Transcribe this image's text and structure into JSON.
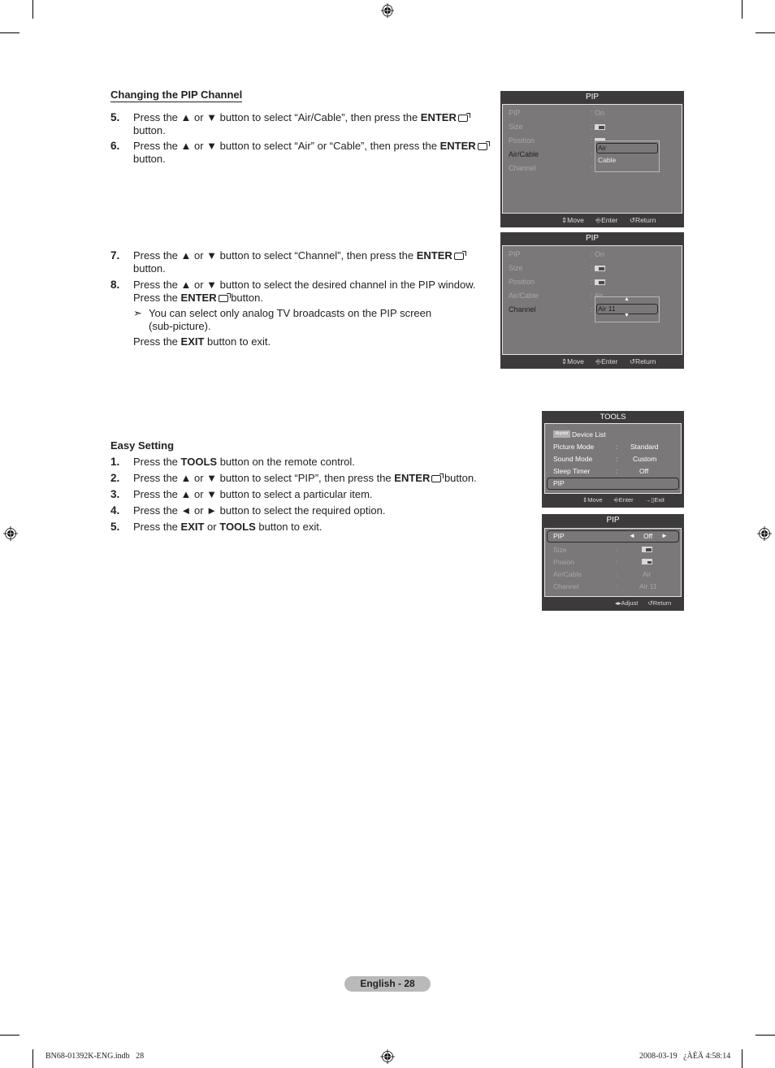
{
  "section1": {
    "heading": "Changing the PIP Channel",
    "steps": [
      {
        "num": "5.",
        "pre": "Press the ▲ or ▼ button to select “Air/Cable”, then press the ",
        "bold": "ENTER",
        "post": " button."
      },
      {
        "num": "6.",
        "pre": "Press the ▲ or ▼ button to select “Air” or “Cable”, then press the ",
        "bold": "ENTER",
        "post": " button."
      },
      {
        "num": "7.",
        "pre": "Press the ▲ or ▼ button to select “Channel”, then press the ",
        "bold": "ENTER",
        "post": " button."
      },
      {
        "num": "8.",
        "line1": "Press the ▲ or ▼ button to select the desired channel in the PIP window.",
        "pre": "Press the ",
        "bold": "ENTER",
        "post": " button."
      }
    ],
    "note_arrow": "➣",
    "note": "You can select only analog TV broadcasts on the PIP screen (sub-picture).",
    "exit_pre": "Press the ",
    "exit_bold": "EXIT",
    "exit_post": " button to exit."
  },
  "section2": {
    "heading": "Easy Setting",
    "steps": [
      {
        "num": "1.",
        "pre": "Press the ",
        "bold": "TOOLS",
        "post": " button on the remote control."
      },
      {
        "num": "2.",
        "pre": "Press the ▲ or ▼ button to select “PIP”, then press the ",
        "bold": "ENTER",
        "post": " button."
      },
      {
        "num": "3.",
        "pre": "Press the ▲ or ▼ button to select a particular item.",
        "bold": "",
        "post": ""
      },
      {
        "num": "4.",
        "pre": "Press the ◄ or ► button to select the required option.",
        "bold": "",
        "post": ""
      },
      {
        "num": "5.",
        "pre": "Press the ",
        "bold": "EXIT",
        "mid": " or ",
        "bold2": "TOOLS",
        "post": " button to exit."
      }
    ]
  },
  "osd1": {
    "title": "PIP",
    "rows": [
      {
        "label": "PIP",
        "value": ": On"
      },
      {
        "label": "Size",
        "value": ":"
      },
      {
        "label": "Position",
        "value": ":"
      },
      {
        "label": "Air/Cable",
        "value": ":"
      },
      {
        "label": "Channel",
        "value": ":"
      }
    ],
    "popup_options": [
      "Air",
      "Cable"
    ],
    "footer": {
      "move": "Move",
      "enter": "Enter",
      "return": "Return"
    }
  },
  "osd2": {
    "title": "PIP",
    "rows": [
      {
        "label": "PIP",
        "value": ": On"
      },
      {
        "label": "Size",
        "value": ":"
      },
      {
        "label": "Position",
        "value": ":"
      },
      {
        "label": "Air/Cable",
        "value": ": Air"
      },
      {
        "label": "Channel",
        "value": ":"
      }
    ],
    "popup_value": "Air 11",
    "footer": {
      "move": "Move",
      "enter": "Enter",
      "return": "Return"
    }
  },
  "tools": {
    "title": "TOOLS",
    "anynet": "Anynet",
    "device_list": "Device List",
    "rows": [
      {
        "label": "Picture Mode",
        "sep": ":",
        "value": "Standard"
      },
      {
        "label": "Sound Mode",
        "sep": ":",
        "value": "Custom"
      },
      {
        "label": "Sleep Timer",
        "sep": ":",
        "value": "Off"
      }
    ],
    "selected": "PIP",
    "footer": {
      "move": "Move",
      "enter": "Enter",
      "exit": "Exit"
    }
  },
  "osd3": {
    "title": "PIP",
    "pip_label": "PIP",
    "pip_value": "Off",
    "rows": [
      {
        "label": "Size",
        "sep": ":",
        "value": ""
      },
      {
        "label": "Posion",
        "sep": ":",
        "value": ""
      },
      {
        "label": "Air/Cable",
        "sep": ":",
        "value": "Air"
      },
      {
        "label": "Channel",
        "sep": ":",
        "value": "Air 11"
      }
    ],
    "footer": {
      "adjust": "Adjust",
      "return": "Return"
    }
  },
  "footer": {
    "page_label": "English - 28",
    "slug_left": "BN68-01392K-ENG.indb   28",
    "slug_right": "2008-03-19   ¿ÀÈÄ 4:58:14"
  }
}
